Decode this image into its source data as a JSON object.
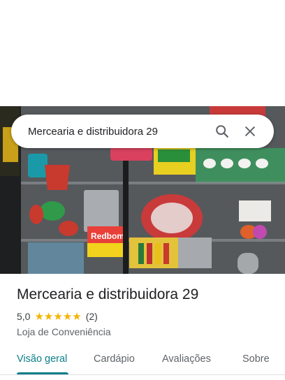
{
  "search": {
    "query": "Mercearia e distribuidora 29",
    "search_icon": "search-icon",
    "clear_icon": "close-icon"
  },
  "photo": {
    "signs": [
      "Redbom"
    ]
  },
  "place": {
    "name": "Mercearia e distribuidora 29",
    "rating": "5,0",
    "star_count": 5,
    "reviews": "(2)",
    "category": "Loja de Conveniência"
  },
  "tabs": [
    {
      "label": "Visão geral",
      "active": true
    },
    {
      "label": "Cardápio",
      "active": false
    },
    {
      "label": "Avaliações",
      "active": false
    },
    {
      "label": "Sobre",
      "active": false
    }
  ],
  "colors": {
    "accent": "#0a7e88",
    "star": "#f4b400",
    "text_primary": "#202124",
    "text_secondary": "#5f6368"
  }
}
